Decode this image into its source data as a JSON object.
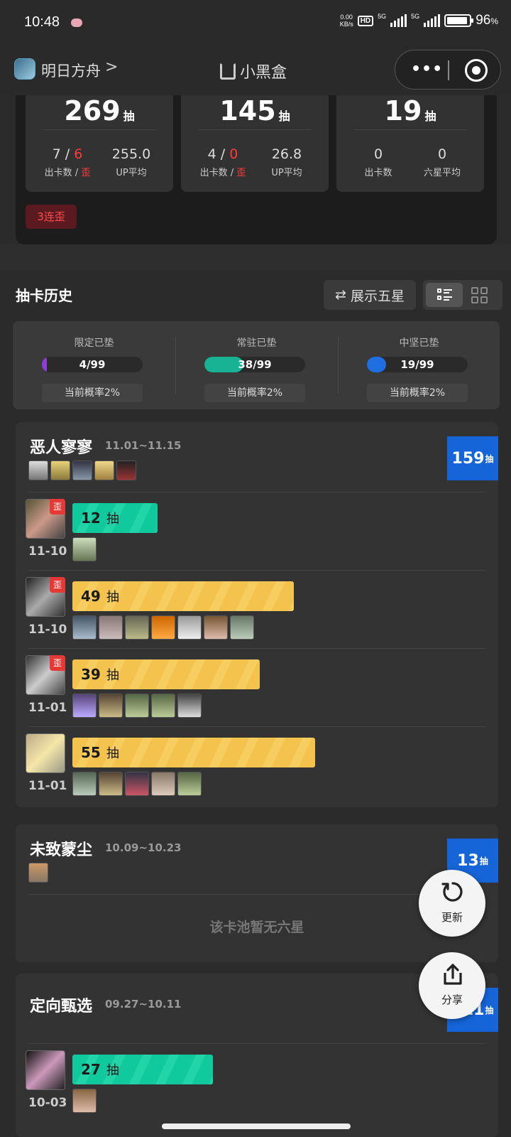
{
  "status_bar": {
    "time": "10:48",
    "net_speed_top": "0.00",
    "net_speed_unit": "KB/s",
    "hd": "HD",
    "net1": "5G",
    "net2": "5G",
    "battery": "96",
    "battery_unit": "%"
  },
  "app_header": {
    "app_name": "明日方舟",
    "chevron": ">",
    "brand": "小黑盒",
    "more": "•••"
  },
  "summary": {
    "cards": [
      {
        "total": "269",
        "unit": "抽",
        "a_val1": "7",
        "a_sep": " / ",
        "a_val2": "6",
        "a_lbl1": "出卡数",
        "a_lbl_sep": " / ",
        "a_lbl2": "歪",
        "b_val": "255.0",
        "b_lbl": "UP平均"
      },
      {
        "total": "145",
        "unit": "抽",
        "a_val1": "4",
        "a_sep": " / ",
        "a_val2": "0",
        "a_lbl1": "出卡数",
        "a_lbl_sep": " / ",
        "a_lbl2": "歪",
        "b_val": "26.8",
        "b_lbl": "UP平均"
      },
      {
        "total": "19",
        "unit": "抽",
        "a_val": "0",
        "a_lbl": "出卡数",
        "b_val": "0",
        "b_lbl": "六星平均"
      }
    ],
    "streak_badge": "3连歪"
  },
  "history": {
    "title": "抽卡历史",
    "toggle_btn": "展示五星",
    "toggle_icon": "⇄"
  },
  "pity": [
    {
      "label": "限定已垫",
      "value": "4/99",
      "ratio": 0.04,
      "color": "#8b3fd6",
      "rate": "当前概率2%"
    },
    {
      "label": "常驻已垫",
      "value": "38/99",
      "ratio": 0.384,
      "color": "#17b394",
      "rate": "当前概率2%"
    },
    {
      "label": "中坚已垫",
      "value": "19/99",
      "ratio": 0.19,
      "color": "#1f6fe0",
      "rate": "当前概率2%"
    }
  ],
  "banners": [
    {
      "name": "恶人寥寥",
      "date": "11.01~11.15",
      "total": "159",
      "unit": "抽"
    },
    {
      "name": "未致蒙尘",
      "date": "10.09~10.23",
      "total": "13",
      "unit": "抽",
      "empty": "该卡池暂无六星"
    },
    {
      "name": "定向甄选",
      "date": "09.27~10.11",
      "total": "111",
      "unit": "抽"
    }
  ],
  "pulls": [
    {
      "count": "12",
      "unit": "抽",
      "date": "11-10",
      "badge": "歪",
      "fill": 0.2,
      "color": "green"
    },
    {
      "count": "49",
      "unit": "抽",
      "date": "11-10",
      "badge": "歪",
      "fill": 0.52,
      "color": "yellow"
    },
    {
      "count": "39",
      "unit": "抽",
      "date": "11-01",
      "badge": "歪",
      "fill": 0.44,
      "color": "yellow"
    },
    {
      "count": "55",
      "unit": "抽",
      "date": "11-01",
      "badge": "",
      "fill": 0.57,
      "color": "yellow"
    },
    {
      "count": "27",
      "unit": "抽",
      "date": "10-03",
      "badge": "",
      "fill": 0.33,
      "color": "green"
    }
  ],
  "fab": {
    "refresh": "更新",
    "share": "分享"
  },
  "colors": {
    "accent_blue": "#1565d8",
    "alert_red": "#e53935",
    "green": "#10c99c",
    "yellow": "#f3c34e"
  }
}
